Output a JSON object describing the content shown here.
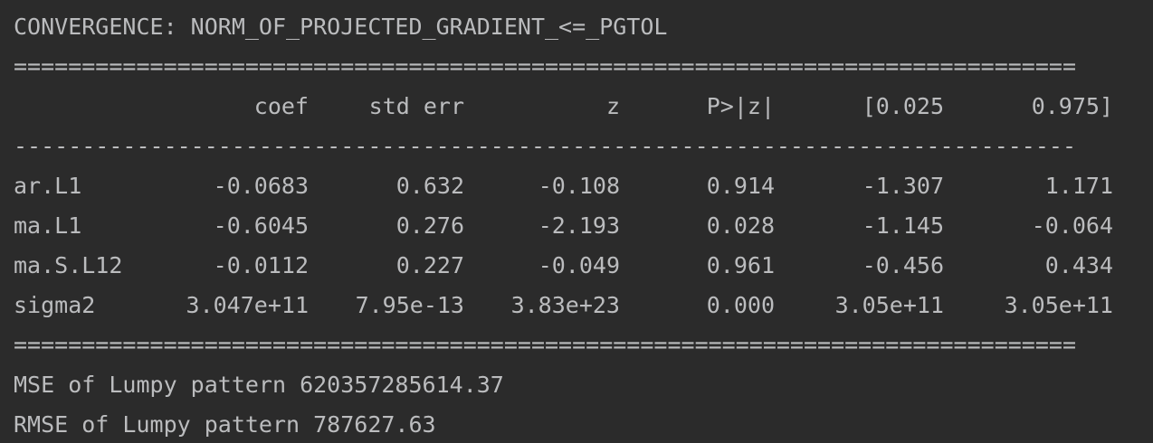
{
  "console": {
    "convergence_line": "CONVERGENCE: NORM_OF_PROJECTED_GRADIENT_<=_PGTOL",
    "double_rule": "==============================================================================",
    "single_rule": "------------------------------------------------------------------------------",
    "table": {
      "headers": [
        "",
        "coef",
        "std err",
        "z",
        "P>|z|",
        "[0.025",
        "0.975]"
      ],
      "rows": [
        [
          "ar.L1",
          "-0.0683",
          "0.632",
          "-0.108",
          "0.914",
          "-1.307",
          "1.171"
        ],
        [
          "ma.L1",
          "-0.6045",
          "0.276",
          "-2.193",
          "0.028",
          "-1.145",
          "-0.064"
        ],
        [
          "ma.S.L12",
          "-0.0112",
          "0.227",
          "-0.049",
          "0.961",
          "-0.456",
          "0.434"
        ],
        [
          "sigma2",
          "3.047e+11",
          "7.95e-13",
          "3.83e+23",
          "0.000",
          "3.05e+11",
          "3.05e+11"
        ]
      ]
    },
    "mse_line": "MSE of Lumpy pattern 620357285614.37",
    "rmse_line": "RMSE of Lumpy pattern 787627.63"
  }
}
